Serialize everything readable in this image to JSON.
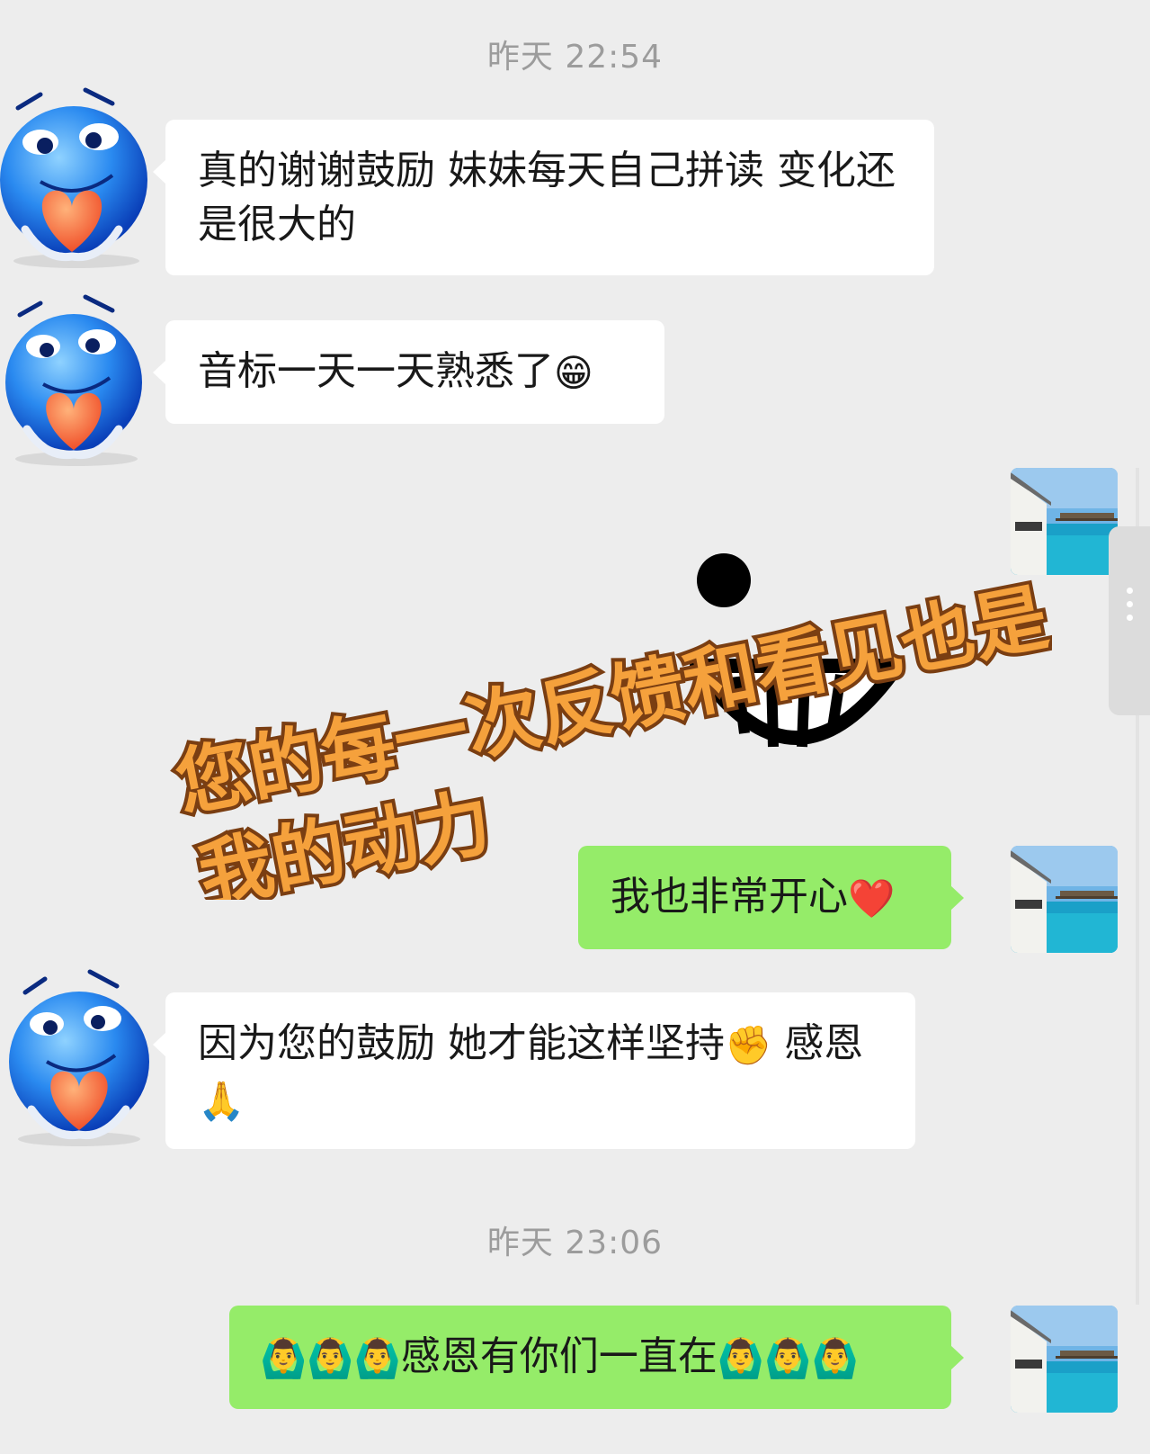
{
  "timestamps": [
    "昨天 22:54",
    "昨天 23:06"
  ],
  "messages": [
    {
      "side": "left",
      "text": "真的谢谢鼓励 妹妹每天自己拼读 变化还是很大的"
    },
    {
      "side": "left",
      "text": "音标一天一天熟悉了",
      "emoji": "😁"
    },
    {
      "side": "right",
      "text": "我也非常开心",
      "emoji": "❤️"
    },
    {
      "side": "left",
      "text": "因为您的鼓励  她才能这样坚持",
      "emoji": "✊",
      "text2": " 感恩",
      "emoji2": "🙏"
    },
    {
      "side": "right",
      "prefix": "🙆‍♂️🙆‍♂️🙆‍♂️",
      "text": "感恩有你们一直在",
      "suffix": "🙆‍♂️🙆‍♂️🙆‍♂️"
    }
  ],
  "overlay": {
    "line1": "您的每一次反馈和看见也是",
    "line2": "我的动力"
  },
  "colors": {
    "background": "#ededed",
    "left_bubble": "#ffffff",
    "right_bubble": "#95ec69",
    "overlay_fill": "#f5a13c",
    "overlay_stroke": "#7a3e12",
    "timestamp": "#9c9c9c"
  },
  "icons": {
    "left_avatar": "blue-smiley-heart-icon",
    "right_avatar": "seaside-villa-photo",
    "decor": "grinning-face-drawing"
  }
}
